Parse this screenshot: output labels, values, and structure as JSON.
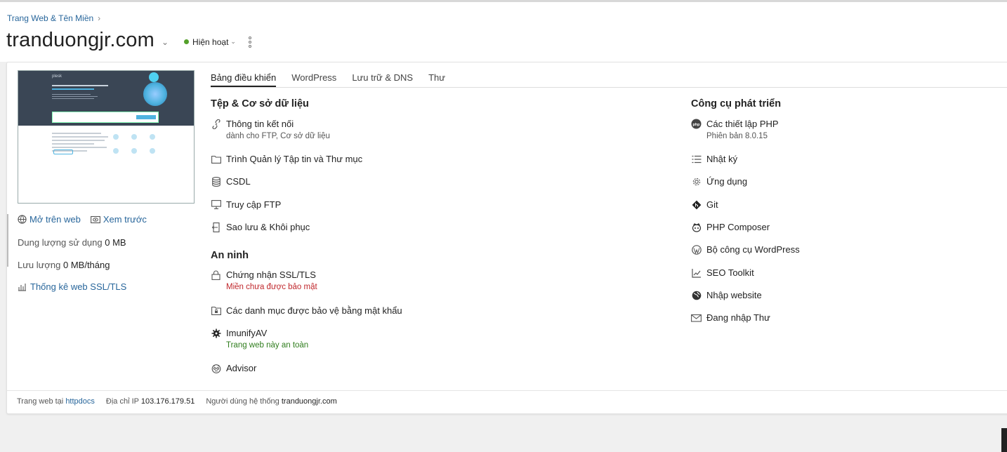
{
  "breadcrumb": {
    "label": "Trang Web & Tên Miền"
  },
  "header": {
    "domain": "tranduongjr.com",
    "status": "Hiện hoạt"
  },
  "left": {
    "open_web": "Mở trên web",
    "preview": "Xem trước",
    "disk_label": "Dung lượng sử dụng",
    "disk_value": "0 MB",
    "traffic_label": "Lưu lượng",
    "traffic_value": "0 MB/tháng",
    "ssl_stats": "Thống kê web SSL/TLS",
    "thumb_brand": "plesk"
  },
  "tabs": [
    "Bảng điều khiển",
    "WordPress",
    "Lưu trữ & DNS",
    "Thư"
  ],
  "files_section": {
    "title": "Tệp & Cơ sở dữ liệu",
    "items": [
      {
        "label": "Thông tin kết nối",
        "sub": "dành cho FTP, Cơ sở dữ liệu",
        "icon": "link-icon"
      },
      {
        "label": "Trình Quản lý Tập tin và Thư mục",
        "icon": "folder-icon"
      },
      {
        "label": "CSDL",
        "icon": "database-icon"
      },
      {
        "label": "Truy cập FTP",
        "icon": "monitor-icon"
      },
      {
        "label": "Sao lưu & Khôi phục",
        "icon": "backup-icon"
      }
    ]
  },
  "security_section": {
    "title": "An ninh",
    "items": [
      {
        "label": "Chứng nhận SSL/TLS",
        "sub": "Miền chưa được bảo mật",
        "icon": "lock-icon"
      },
      {
        "label": "Các danh mục được bảo vệ bằng mật khẩu",
        "icon": "protected-folder-icon"
      },
      {
        "label": "ImunifyAV",
        "sub": "Trang web này an toàn",
        "icon": "imunify-icon"
      },
      {
        "label": "Advisor",
        "icon": "advisor-icon"
      }
    ]
  },
  "dev_section": {
    "title": "Công cụ phát triển",
    "items": [
      {
        "label": "Các thiết lập PHP",
        "sub": "Phiên bản 8.0.15",
        "icon": "php-icon"
      },
      {
        "label": "Nhật ký",
        "icon": "log-icon"
      },
      {
        "label": "Ứng dụng",
        "icon": "gear-icon"
      },
      {
        "label": "Git",
        "icon": "git-icon"
      },
      {
        "label": "PHP Composer",
        "icon": "composer-icon"
      },
      {
        "label": "Bộ công cụ WordPress",
        "icon": "wordpress-icon"
      },
      {
        "label": "SEO Toolkit",
        "icon": "seo-icon"
      },
      {
        "label": "Nhập website",
        "icon": "globe-icon"
      },
      {
        "label": "Đang nhập Thư",
        "icon": "mail-icon"
      }
    ]
  },
  "footer": {
    "docroot_label": "Trang web tại",
    "docroot_value": "httpdocs",
    "ip_label": "Địa chỉ IP",
    "ip_value": "103.176.179.51",
    "user_label": "Người dùng hệ thống",
    "user_value": "tranduongjr.com"
  },
  "colors": {
    "link": "#28669b",
    "active_dot": "#54a02a",
    "error": "#c0282d",
    "ok": "#2f7d1d"
  }
}
